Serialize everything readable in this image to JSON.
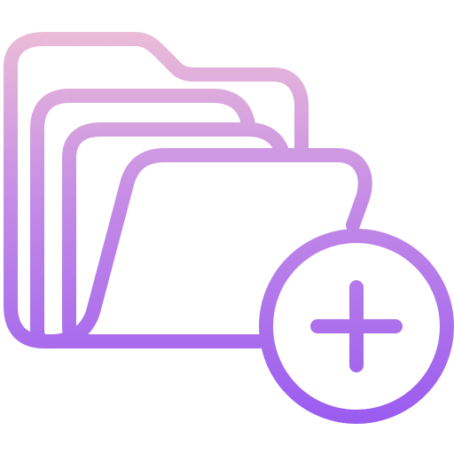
{
  "icon": {
    "name": "add-folder-icon",
    "colors": {
      "gradient_top": "#ebbcd8",
      "gradient_mid": "#c38ae6",
      "gradient_bottom": "#9a5cf0"
    }
  }
}
